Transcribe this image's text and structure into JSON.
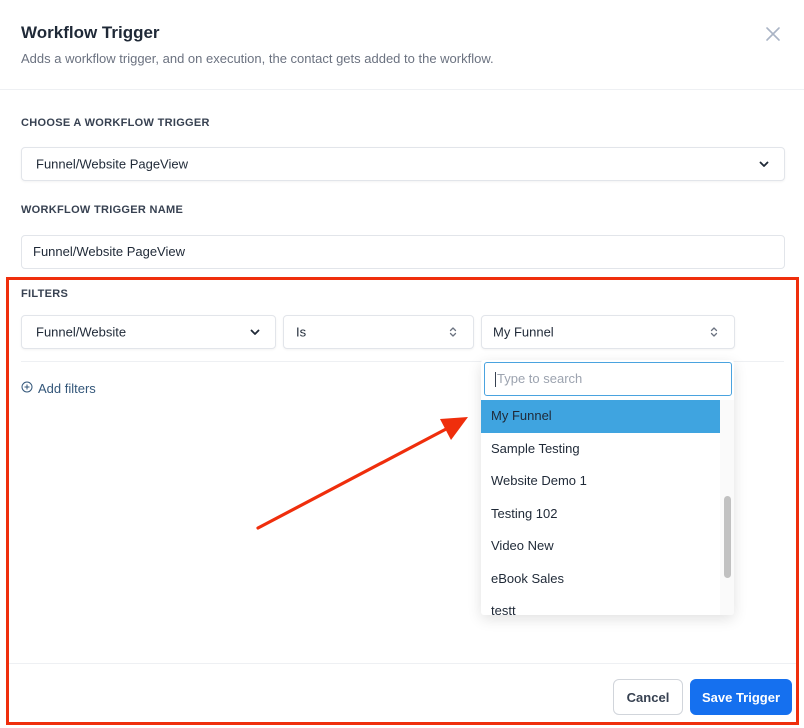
{
  "header": {
    "title": "Workflow Trigger",
    "subtitle": "Adds a workflow trigger, and on execution, the contact gets added to the workflow.",
    "close_icon": "close-icon"
  },
  "trigger": {
    "label": "CHOOSE A WORKFLOW TRIGGER",
    "selected": "Funnel/Website PageView"
  },
  "trigger_name": {
    "label": "WORKFLOW TRIGGER NAME",
    "value": "Funnel/Website PageView"
  },
  "filters": {
    "label": "FILTERS",
    "field": "Funnel/Website",
    "operator": "Is",
    "value": "My Funnel",
    "add_label": "Add filters"
  },
  "dropdown": {
    "search_placeholder": "Type to search",
    "options": [
      "My Funnel",
      "Sample Testing",
      "Website Demo 1",
      "Testing 102",
      "Video New",
      "eBook Sales",
      "testt"
    ],
    "selected_index": 0
  },
  "footer": {
    "cancel_label": "Cancel",
    "save_label": "Save Trigger"
  },
  "colors": {
    "accent": "#1570ef",
    "highlight_annotation": "#ef2e0c",
    "selected_option": "#3fa4e0",
    "link": "#34577a"
  }
}
